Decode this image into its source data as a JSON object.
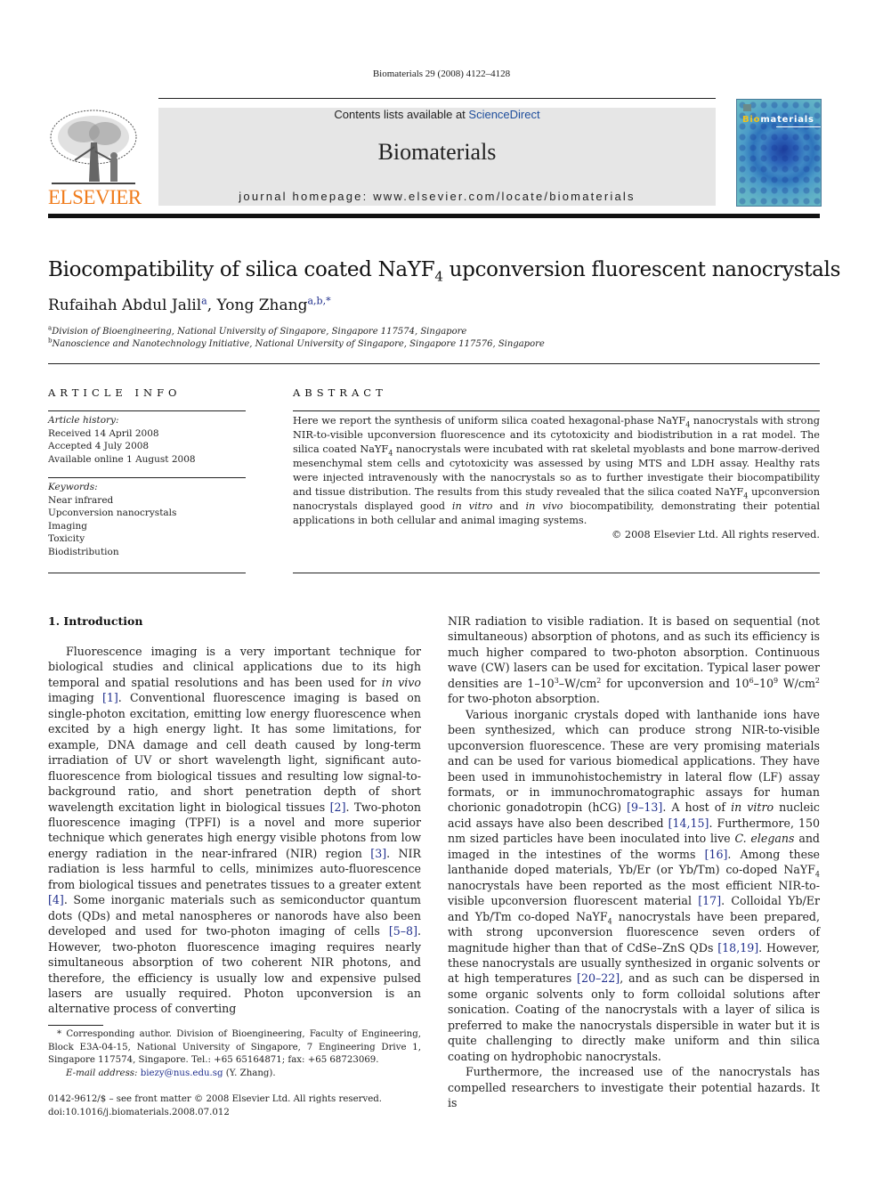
{
  "header": {
    "citation": "Biomaterials 29 (2008) 4122–4128",
    "publisher_logo_text": "ELSEVIER",
    "contents_prefix": "Contents lists available at ",
    "contents_link": "ScienceDirect",
    "journal_name": "Biomaterials",
    "homepage": "journal homepage: www.elsevier.com/locate/biomaterials",
    "cover_title_highlight": "Bio",
    "cover_title_rest": "materials",
    "colors": {
      "logo_orange": "#f07c1c",
      "link_blue": "#1f4e9c",
      "banner_gray": "#e6e6e6"
    }
  },
  "article": {
    "title_pre": "Biocompatibility of silica coated NaYF",
    "title_sub": "4",
    "title_post": " upconversion fluorescent nanocrystals",
    "authors": [
      {
        "name": "Rufaihah Abdul Jalil",
        "marks": "a",
        "sep": ", "
      },
      {
        "name": "Yong Zhang",
        "marks": "a,b,",
        "star": "*"
      }
    ],
    "affiliations": [
      {
        "mark": "a",
        "text": "Division of Bioengineering, National University of Singapore, Singapore 117574, Singapore"
      },
      {
        "mark": "b",
        "text": "Nanoscience and Nanotechnology Initiative, National University of Singapore, Singapore 117576, Singapore"
      }
    ]
  },
  "article_info": {
    "heading": "ARTICLE INFO",
    "history_label": "Article history:",
    "history": [
      "Received 14 April 2008",
      "Accepted 4 July 2008",
      "Available online 1 August 2008"
    ],
    "keywords_label": "Keywords:",
    "keywords": [
      "Near infrared",
      "Upconversion nanocrystals",
      "Imaging",
      "Toxicity",
      "Biodistribution"
    ]
  },
  "abstract": {
    "heading": "ABSTRACT",
    "p1": "Here we report the synthesis of uniform silica coated hexagonal-phase NaYF",
    "p2": " nanocrystals with strong NIR-to-visible upconversion fluorescence and its cytotoxicity and biodistribution in a rat model. The silica coated NaYF",
    "p3": " nanocrystals were incubated with rat skeletal myoblasts and bone marrow-derived mesenchymal stem cells and cytotoxicity was assessed by using MTS and LDH assay. Healthy rats were injected intravenously with the nanocrystals so as to further investigate their biocompatibility and tissue distribution. The results from this study revealed that the silica coated NaYF",
    "p4": " upconversion nanocrystals displayed good ",
    "it1": "in vitro",
    "p5": " and ",
    "it2": "in vivo",
    "p6": " biocompatibility, demonstrating their potential applications in both cellular and animal imaging systems.",
    "sub": "4",
    "copyright": "© 2008 Elsevier Ltd. All rights reserved."
  },
  "intro": {
    "heading": "1.  Introduction",
    "left": {
      "a": "Fluorescence imaging is a very important technique for biological studies and clinical applications due to its high temporal and spatial resolutions and has been used for ",
      "a_it": "in vivo",
      "b": " imaging ",
      "r1": "[1]",
      "c": ". Conventional fluorescence imaging is based on single-photon excitation, emitting low energy fluorescence when excited by a high energy light. It has some limitations, for example, DNA damage and cell death caused by long-term irradiation of UV or short wavelength light, significant auto-fluorescence from biological tissues and resulting low signal-to-background ratio, and short penetration depth of short wavelength excitation light in biological tissues ",
      "r2": "[2]",
      "d": ". Two-photon fluorescence imaging (TPFI) is a novel and more superior technique which generates high energy visible photons from low energy radiation in the near-infrared (NIR) region ",
      "r3": "[3]",
      "e": ". NIR radiation is less harmful to cells, minimizes auto-fluorescence from biological tissues and penetrates tissues to a greater extent ",
      "r4": "[4]",
      "f": ". Some inorganic materials such as semiconductor quantum dots (QDs) and metal nanospheres or nanorods have also been developed and used for two-photon imaging of cells ",
      "r5": "[5–8]",
      "g": ". However, two-photon fluorescence imaging requires nearly simultaneous absorption of two coherent NIR photons, and therefore, the efficiency is usually low and expensive pulsed lasers are usually required. Photon upconversion is an alternative process of converting"
    },
    "right": {
      "a": "NIR radiation to visible radiation. It is based on sequential (not simultaneous) absorption of photons, and as such its efficiency is much higher compared to two-photon absorption. Continuous wave (CW) lasers can be used for excitation. Typical laser power densities are 1–10",
      "a_sup1": "3",
      "a2": "–W/cm",
      "a_sup2": "2",
      "a3": " for upconversion and 10",
      "a_sup3": "6",
      "a4": "–10",
      "a_sup4": "9",
      "a5": " W/cm",
      "a_sup5": "2",
      "a6": " for two-photon absorption.",
      "b": "Various inorganic crystals doped with lanthanide ions have been synthesized, which can produce strong NIR-to-visible upconversion fluorescence. These are very promising materials and can be used for various biomedical applications. They have been used in immunohistochemistry in lateral flow (LF) assay formats, or in immunochromatographic assays for human chorionic gonadotropin (hCG) ",
      "r9": "[9–13]",
      "b2": ". A host of ",
      "b_it": "in vitro",
      "b3": " nucleic acid assays have also been described ",
      "r14": "[14,15]",
      "b4": ". Furthermore, 150 nm sized particles have been inoculated into live ",
      "b_it2": "C. elegans",
      "b5": " and imaged in the intestines of the worms ",
      "r16": "[16]",
      "b6": ". Among these lanthanide doped materials, Yb/Er (or Yb/Tm) co-doped NaYF",
      "sub": "4",
      "b7": " nanocrystals have been reported as the most efficient NIR-to-visible upconversion fluorescent material ",
      "r17": "[17]",
      "b8": ". Colloidal Yb/Er and Yb/Tm co-doped NaYF",
      "b9": " nanocrystals have been prepared, with strong upconversion fluorescence seven orders of magnitude higher than that of CdSe–ZnS QDs ",
      "r18": "[18,19]",
      "b10": ". However, these nanocrystals are usually synthesized in organic solvents or at high temperatures ",
      "r20": "[20–22]",
      "b11": ", and as such can be dispersed in some organic solvents only to form colloidal solutions after sonication. Coating of the nanocrystals with a layer of silica is preferred to make the nanocrystals dispersible in water but it is quite challenging to directly make uniform and thin silica coating on hydrophobic nanocrystals.",
      "c": "Furthermore, the increased use of the nanocrystals has compelled researchers to investigate their potential hazards. It is"
    }
  },
  "footnote": {
    "text": "* Corresponding author. Division of Bioengineering, Faculty of Engineering, Block E3A-04-15, National University of Singapore, 7 Engineering Drive 1, Singapore 117574, Singapore. Tel.: +65 65164871; fax: +65 68723069.",
    "email_label": "E-mail address:",
    "email": "biezy@nus.edu.sg",
    "email_suffix": " (Y. Zhang)."
  },
  "bottom": {
    "issn": "0142-9612/$ – see front matter © 2008 Elsevier Ltd. All rights reserved.",
    "doi": "doi:10.1016/j.biomaterials.2008.07.012"
  }
}
